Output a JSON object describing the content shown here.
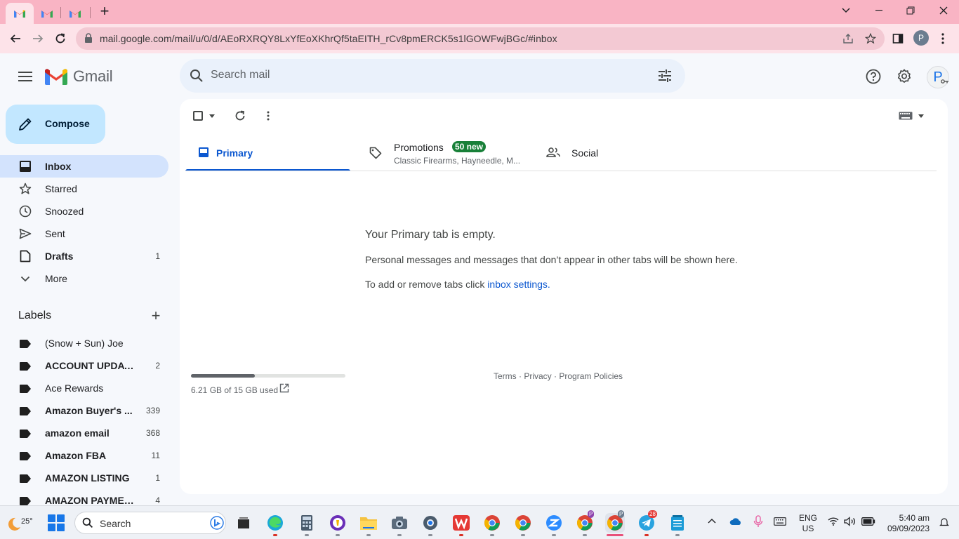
{
  "browser": {
    "tabs": [
      {
        "icon": "gmail-icon",
        "active": true
      },
      {
        "icon": "gmail-icon",
        "active": false
      },
      {
        "icon": "gmail-icon",
        "active": false
      }
    ],
    "new_tab_label": "+",
    "url": "mail.google.com/mail/u/0/d/AEoRXRQY8LxYfEoXKhrQf5taEITH_rCv8pmERCK5s1lGOWFwjBGc/#inbox",
    "profile_initial": "P"
  },
  "gmail": {
    "brand": "Gmail",
    "search_placeholder": "Search mail",
    "avatar_initial": "P",
    "compose_label": "Compose",
    "nav": [
      {
        "label": "Inbox",
        "icon": "inbox-icon",
        "bold": true,
        "active": true,
        "count": ""
      },
      {
        "label": "Starred",
        "icon": "star-icon",
        "bold": false,
        "active": false,
        "count": ""
      },
      {
        "label": "Snoozed",
        "icon": "clock-icon",
        "bold": false,
        "active": false,
        "count": ""
      },
      {
        "label": "Sent",
        "icon": "send-icon",
        "bold": false,
        "active": false,
        "count": ""
      },
      {
        "label": "Drafts",
        "icon": "draft-icon",
        "bold": true,
        "active": false,
        "count": "1"
      },
      {
        "label": "More",
        "icon": "chevron-down-icon",
        "bold": false,
        "active": false,
        "count": ""
      }
    ],
    "labels_heading": "Labels",
    "labels": [
      {
        "name": "(Snow + Sun) Joe",
        "bold": false,
        "count": ""
      },
      {
        "name": "ACCOUNT UPDATE",
        "bold": true,
        "count": "2"
      },
      {
        "name": "Ace Rewards",
        "bold": false,
        "count": ""
      },
      {
        "name": "Amazon Buyer's ...",
        "bold": true,
        "count": "339"
      },
      {
        "name": "amazon email",
        "bold": true,
        "count": "368"
      },
      {
        "name": "Amazon FBA",
        "bold": true,
        "count": "11"
      },
      {
        "name": "AMAZON LISTING",
        "bold": true,
        "count": "1"
      },
      {
        "name": "AMAZON PAYMENT",
        "bold": true,
        "count": "4"
      }
    ],
    "tabs": {
      "primary": "Primary",
      "promotions": "Promotions",
      "promotions_badge": "50 new",
      "promotions_sub": "Classic Firearms, Hayneedle, M...",
      "social": "Social"
    },
    "empty": {
      "title": "Your Primary tab is empty.",
      "description": "Personal messages and messages that don’t appear in other tabs will be shown here.",
      "tabs_prefix": "To add or remove tabs click ",
      "tabs_link": "inbox settings",
      "tabs_suffix": "."
    },
    "storage": {
      "text": "6.21 GB of 15 GB used",
      "used_fraction": 0.414
    },
    "footer": {
      "terms": "Terms",
      "sep1": " · ",
      "privacy": "Privacy",
      "sep2": " · ",
      "policies": "Program Policies"
    }
  },
  "taskbar": {
    "weather_temp": "25°",
    "search_label": "Search",
    "language_line1": "ENG",
    "language_line2": "US",
    "time": "5:40 am",
    "date": "09/09/2023",
    "telegram_badge": "28",
    "profile_badge_1": "P",
    "profile_badge_2": "P"
  },
  "colors": {
    "tabstrip": "#f9b4c4",
    "toolbar": "#fde3e9",
    "compose_bg": "#c2e7ff",
    "active_nav": "#d3e3fd",
    "accent": "#0b57d0",
    "badge_green": "#188038"
  }
}
